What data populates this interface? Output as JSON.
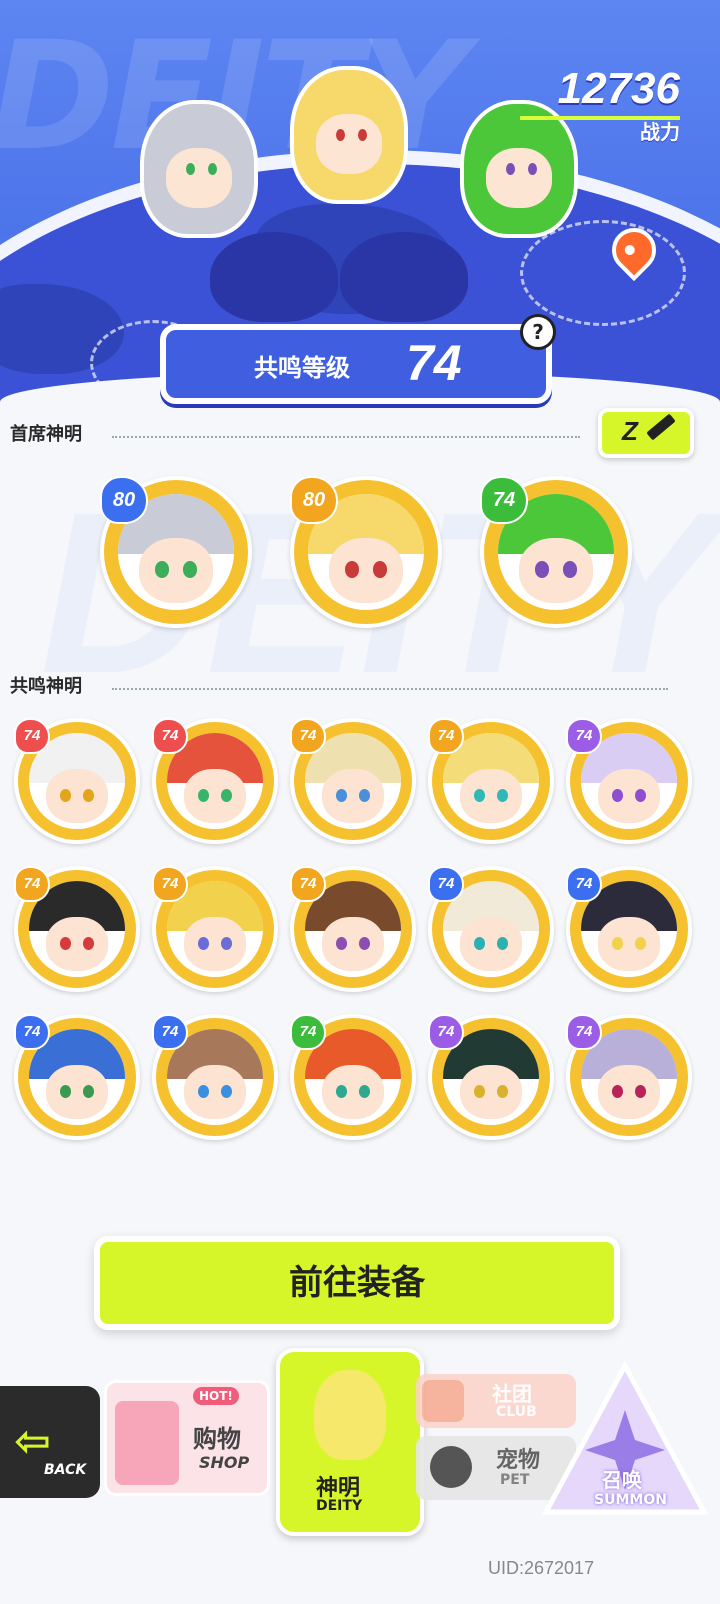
{
  "hero": {
    "bg_word": "DEITY",
    "power_value": "12736",
    "power_label": "战力",
    "resonance_label": "共鸣等级",
    "resonance_level": "74",
    "help_symbol": "?"
  },
  "sections": {
    "chief_title": "首席神明",
    "resonance_title": "共鸣神明",
    "watermark": "DEITY"
  },
  "chief_deities": [
    {
      "level": "80",
      "badge_color": "#3b6ff0",
      "hair": "#c9ccd6",
      "eye": "#3cae5a"
    },
    {
      "level": "80",
      "badge_color": "#f2a51e",
      "hair": "#f6d96a",
      "eye": "#c93a3a"
    },
    {
      "level": "74",
      "badge_color": "#3bbd3b",
      "hair": "#4cc739",
      "eye": "#7a4fb8"
    }
  ],
  "resonance_deities": [
    {
      "level": "74",
      "badge_color": "#ef4e4e",
      "hair": "#f1f1f1",
      "eye": "#e3a51a"
    },
    {
      "level": "74",
      "badge_color": "#ef4e4e",
      "hair": "#e6533c",
      "eye": "#3bb46b"
    },
    {
      "level": "74",
      "badge_color": "#f2a51e",
      "hair": "#efe0b0",
      "eye": "#4a8fd8"
    },
    {
      "level": "74",
      "badge_color": "#f2a51e",
      "hair": "#f4dd78",
      "eye": "#2fb8b8"
    },
    {
      "level": "74",
      "badge_color": "#9b5de5",
      "hair": "#d9cdf3",
      "eye": "#8d4fd0"
    },
    {
      "level": "74",
      "badge_color": "#f2a51e",
      "hair": "#2a2a2a",
      "eye": "#d63a3a"
    },
    {
      "level": "74",
      "badge_color": "#f2a51e",
      "hair": "#f2d14d",
      "eye": "#6c6cd6"
    },
    {
      "level": "74",
      "badge_color": "#f2a51e",
      "hair": "#7a4a2c",
      "eye": "#8a4fb0"
    },
    {
      "level": "74",
      "badge_color": "#3b6ff0",
      "hair": "#f1ead8",
      "eye": "#2fb0b0"
    },
    {
      "level": "74",
      "badge_color": "#3b6ff0",
      "hair": "#2b2b3b",
      "eye": "#f2d14d"
    },
    {
      "level": "74",
      "badge_color": "#3b6ff0",
      "hair": "#3a6fd6",
      "eye": "#3a9a50"
    },
    {
      "level": "74",
      "badge_color": "#3b6ff0",
      "hair": "#a8785a",
      "eye": "#3b8fe0"
    },
    {
      "level": "74",
      "badge_color": "#3bbd3b",
      "hair": "#e85a2a",
      "eye": "#2fa890"
    },
    {
      "level": "74",
      "badge_color": "#9b5de5",
      "hair": "#223a34",
      "eye": "#d9b12a"
    },
    {
      "level": "74",
      "badge_color": "#9b5de5",
      "hair": "#b8b0d8",
      "eye": "#b8245a"
    }
  ],
  "actions": {
    "goto_equipment": "前往装备",
    "edit_icon_letter": "Z"
  },
  "bottom_nav": {
    "back": "BACK",
    "shop_cn": "购物",
    "shop_en": "SHOP",
    "shop_tag": "HOT!",
    "deity_cn": "神明",
    "deity_en": "DEITY",
    "club_cn": "社团",
    "club_en": "CLUB",
    "pet_cn": "宠物",
    "pet_en": "PET",
    "summon_cn": "召唤",
    "summon_en": "SUMMON"
  },
  "uid": "UID:2672017"
}
